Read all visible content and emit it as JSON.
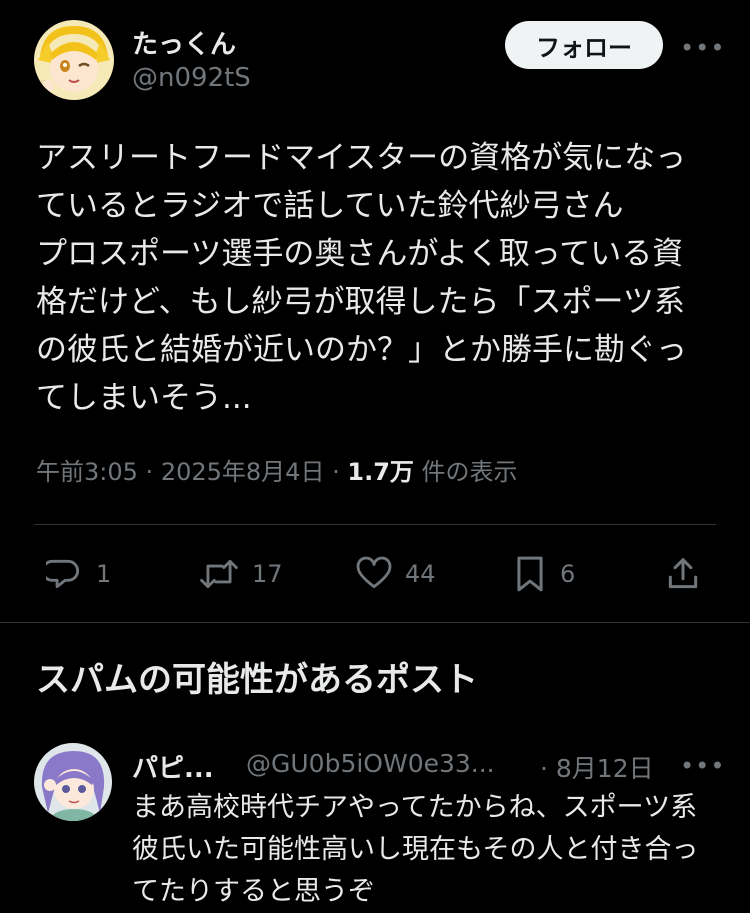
{
  "post": {
    "author_name": "たっくん",
    "author_handle": "@n092tS",
    "follow_label": "フォロー",
    "more_label": "•••",
    "body": "アスリートフードマイスターの資格が気になっ\nているとラジオで話していた鈴代紗弓さん\nプロスポーツ選手の奥さんがよく取っている資\n格だけど、もし紗弓が取得したら「スポーツ系\nの彼氏と結婚が近いのか？」とか勝手に勘ぐっ\nてしまいそう...",
    "time": "午前3:05",
    "date": "2025年8月4日",
    "views_count": "1.7万",
    "views_label": "件の表示",
    "separator": "·",
    "actions": {
      "reply": "1",
      "repost": "17",
      "like": "44",
      "bookmark": "6"
    }
  },
  "section": {
    "title": "スパムの可能性があるポスト"
  },
  "reply": {
    "author_name": "パピ...",
    "author_handle": "@GU0b5iOW0e33...",
    "date": "· 8月12日",
    "more_label": "•••",
    "body": "まあ高校時代チアやってたからね、スポーツ系彼氏いた可能性高いし現在もその人と付き合ってたりすると思うぞ"
  },
  "colors": {
    "background": "#000000",
    "text": "#e7e9ea",
    "secondary": "#71767b",
    "divider": "#2f3336",
    "follow_bg": "#eff3f4"
  },
  "icons": [
    "reply-icon",
    "repost-icon",
    "like-icon",
    "bookmark-icon",
    "share-icon",
    "more-icon"
  ]
}
